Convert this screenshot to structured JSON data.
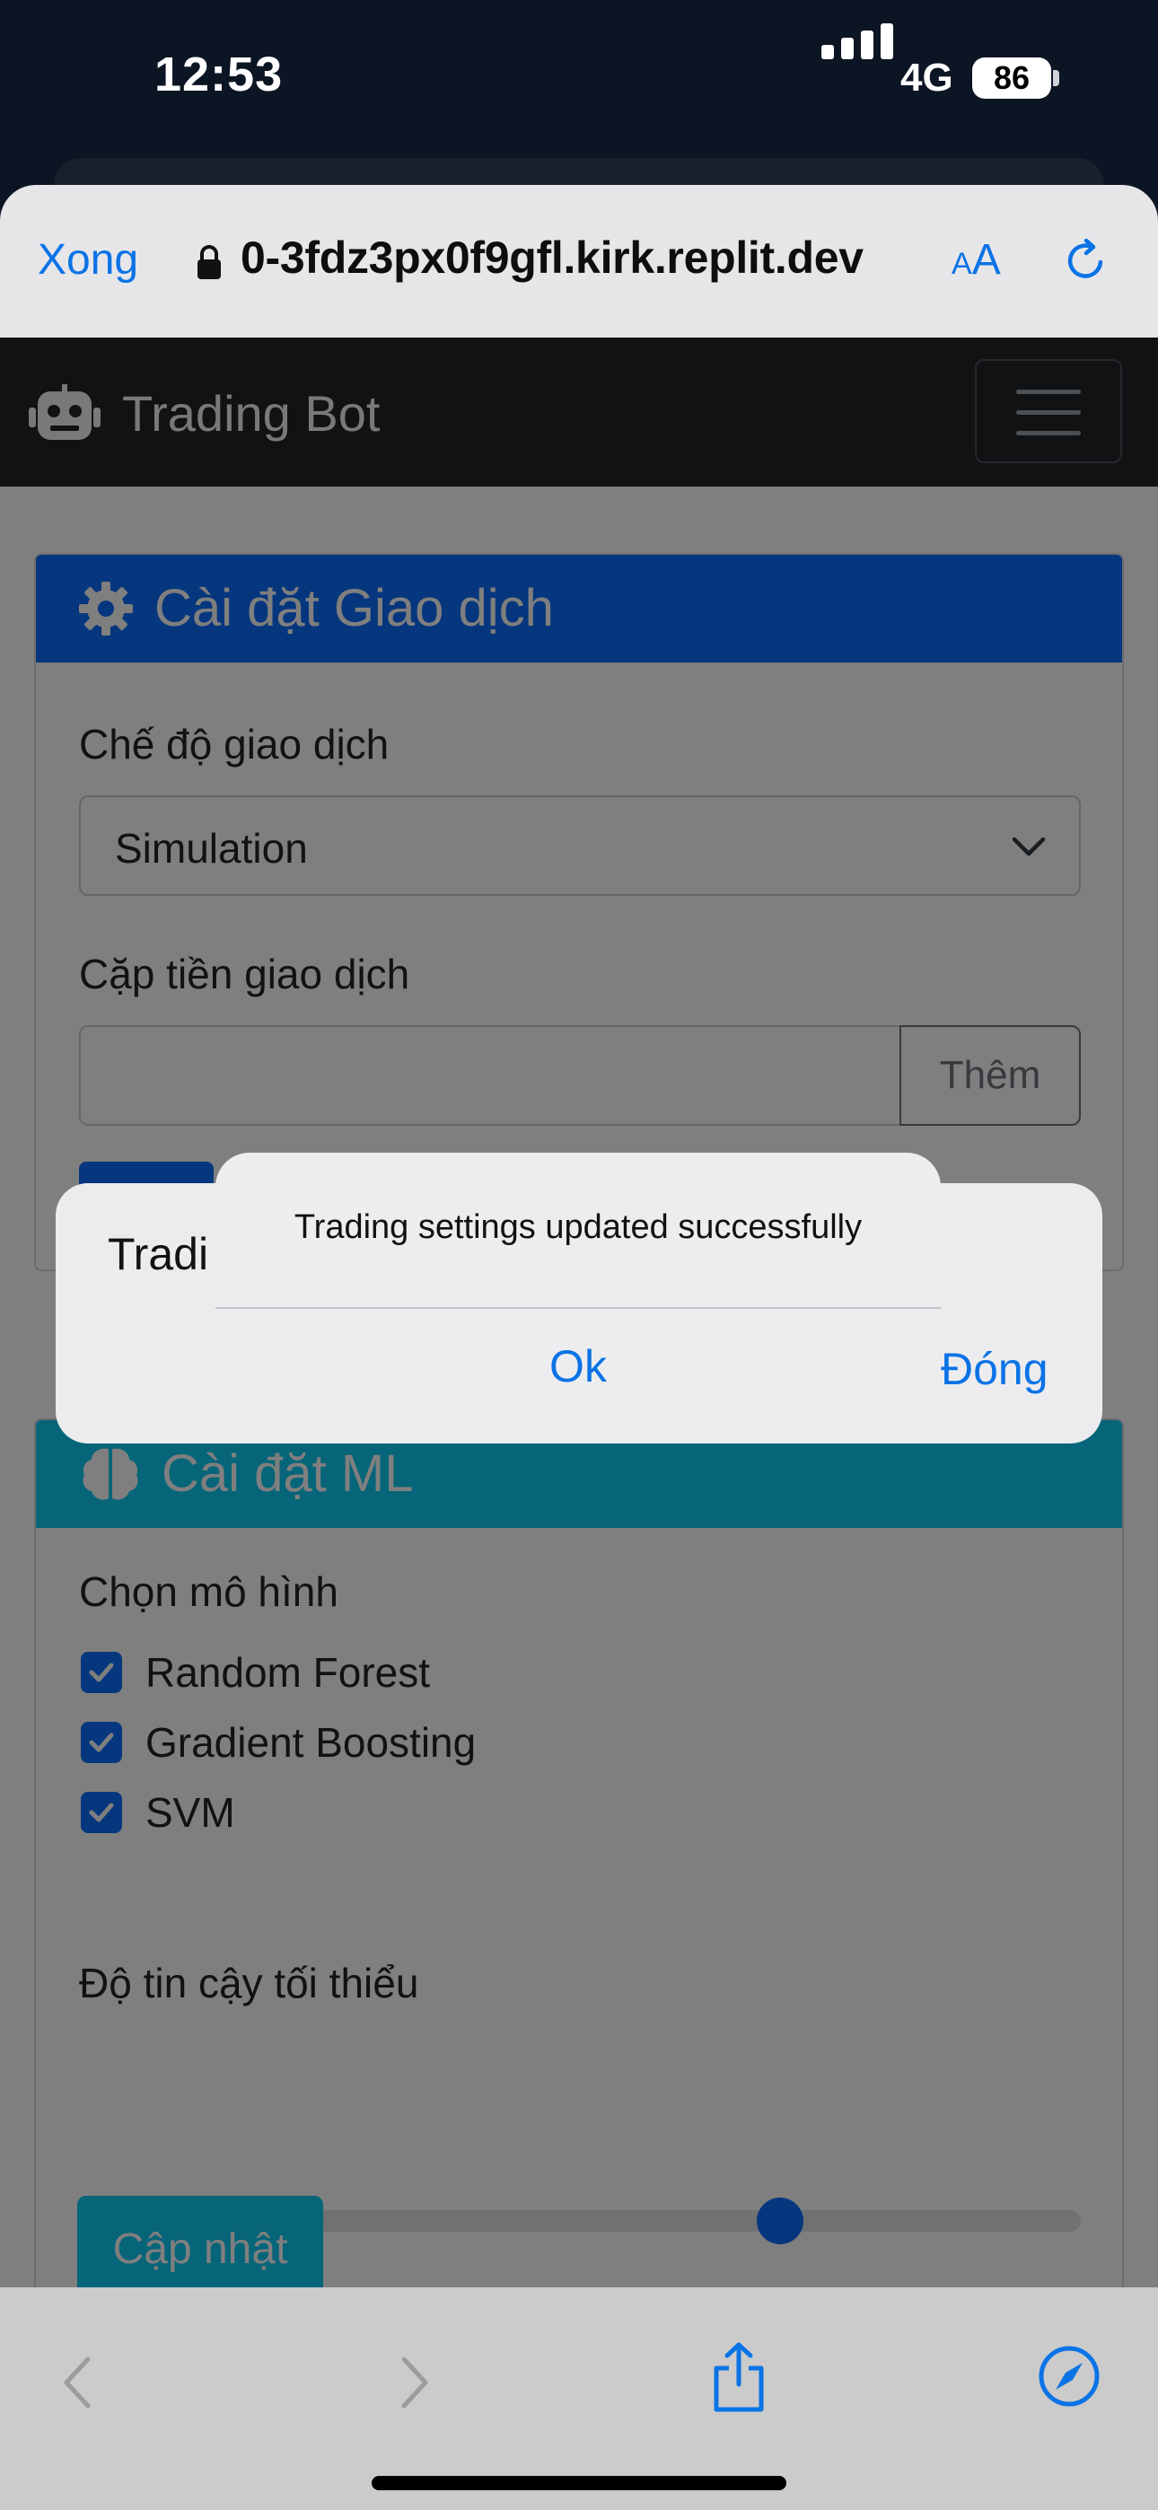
{
  "status_bar": {
    "time": "12:53",
    "network": "4G",
    "battery": "86"
  },
  "safari": {
    "done_label": "Xong",
    "url": "0-3fdz3px0f9gfl.kirk.replit.dev",
    "text_size_small": "A",
    "text_size_large": "A"
  },
  "navbar": {
    "brand": "Trading Bot"
  },
  "trading_settings": {
    "title": "Cài đặt Giao dịch",
    "mode_label": "Chế độ giao dịch",
    "mode_value": "Simulation",
    "pair_label": "Cặp tiền giao dịch",
    "add_button": "Thêm"
  },
  "ml_settings": {
    "title": "Cài đặt ML",
    "model_label": "Chọn mô hình",
    "models": [
      "Random Forest",
      "Gradient Boosting",
      "SVM"
    ],
    "confidence_label": "Độ tin cậy tối thiểu",
    "confidence_value": "70%",
    "confidence_fraction": 0.7,
    "update_button": "Cập nhật"
  },
  "modal": {
    "title_partial": "Tradi",
    "close_button": "Đóng"
  },
  "alert": {
    "message": "Trading settings updated successfully",
    "ok_button": "Ok"
  },
  "colors": {
    "primary": "#0d6efd",
    "info": "#0dcaf0",
    "navbar": "#212529",
    "ios_blue": "#0a73e6"
  }
}
